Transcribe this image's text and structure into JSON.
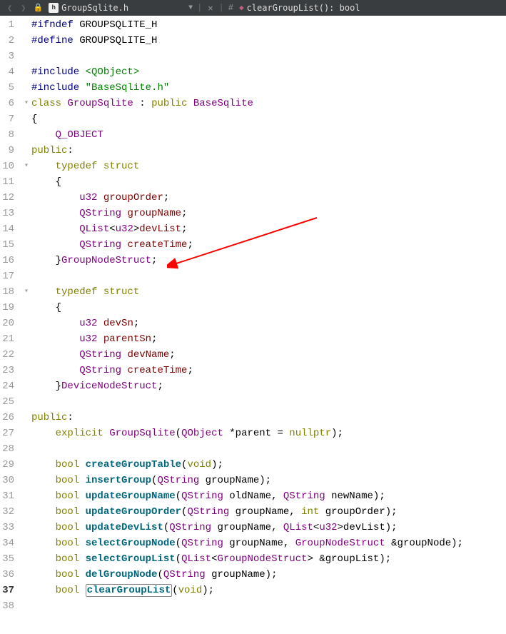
{
  "toolbar": {
    "file_icon": "h",
    "file_name": "GroupSqlite.h",
    "dropdown": "▼",
    "close": "✕",
    "sep": "|",
    "hash": "#",
    "func_icon": "◆",
    "func_sig": "clearGroupList(): bool"
  },
  "gutter": [
    "1",
    "2",
    "3",
    "4",
    "5",
    "6",
    "7",
    "8",
    "9",
    "10",
    "11",
    "12",
    "13",
    "14",
    "15",
    "16",
    "17",
    "18",
    "19",
    "20",
    "21",
    "22",
    "23",
    "24",
    "25",
    "26",
    "27",
    "28",
    "29",
    "30",
    "31",
    "32",
    "33",
    "34",
    "35",
    "36",
    "37",
    "38"
  ],
  "fold_markers": {
    "5": "▾",
    "9": "▾",
    "17": "▾"
  },
  "code": {
    "l1": {
      "a": "#ifndef",
      "b": " GROUPSQLITE_H"
    },
    "l2": {
      "a": "#define",
      "b": " GROUPSQLITE_H"
    },
    "l4": {
      "a": "#include ",
      "b": "<QObject>"
    },
    "l5": {
      "a": "#include ",
      "b": "\"BaseSqlite.h\""
    },
    "l6": {
      "a": "class ",
      "b": "GroupSqlite",
      "c": " : ",
      "d": "public ",
      "e": "BaseSqlite"
    },
    "l7": "{",
    "l8": {
      "a": "    ",
      "b": "Q_OBJECT"
    },
    "l9": {
      "a": "public",
      "b": ":"
    },
    "l10": {
      "a": "    ",
      "b": "typedef struct"
    },
    "l11": "    {",
    "l12": {
      "a": "        ",
      "b": "u32",
      "c": " ",
      "d": "groupOrder",
      "e": ";"
    },
    "l13": {
      "a": "        ",
      "b": "QString",
      "c": " ",
      "d": "groupName",
      "e": ";"
    },
    "l14": {
      "a": "        ",
      "b": "QList",
      "c": "<",
      "d": "u32",
      "e": ">",
      "f": "devList",
      "g": ";"
    },
    "l15": {
      "a": "        ",
      "b": "QString",
      "c": " ",
      "d": "createTime",
      "e": ";"
    },
    "l16": {
      "a": "    }",
      "b": "GroupNodeStruct",
      "c": ";"
    },
    "l18": {
      "a": "    ",
      "b": "typedef struct"
    },
    "l19": "    {",
    "l20": {
      "a": "        ",
      "b": "u32",
      "c": " ",
      "d": "devSn",
      "e": ";"
    },
    "l21": {
      "a": "        ",
      "b": "u32",
      "c": " ",
      "d": "parentSn",
      "e": ";"
    },
    "l22": {
      "a": "        ",
      "b": "QString",
      "c": " ",
      "d": "devName",
      "e": ";"
    },
    "l23": {
      "a": "        ",
      "b": "QString",
      "c": " ",
      "d": "createTime",
      "e": ";"
    },
    "l24": {
      "a": "    }",
      "b": "DeviceNodeStruct",
      "c": ";"
    },
    "l26": {
      "a": "public",
      "b": ":"
    },
    "l27": {
      "a": "    ",
      "b": "explicit ",
      "c": "GroupSqlite",
      "d": "(",
      "e": "QObject",
      "f": " *parent = ",
      "g": "nullptr",
      "h": ");"
    },
    "l29": {
      "a": "    ",
      "b": "bool ",
      "c": "createGroupTable",
      "d": "(",
      "e": "void",
      "f": ");"
    },
    "l30": {
      "a": "    ",
      "b": "bool ",
      "c": "insertGroup",
      "d": "(",
      "e": "QString",
      "f": " groupName);"
    },
    "l31": {
      "a": "    ",
      "b": "bool ",
      "c": "updateGroupName",
      "d": "(",
      "e": "QString",
      "f": " oldName, ",
      "g": "QString",
      "h": " newName);"
    },
    "l32": {
      "a": "    ",
      "b": "bool ",
      "c": "updateGroupOrder",
      "d": "(",
      "e": "QString",
      "f": " groupName, ",
      "g": "int",
      "h": " groupOrder);"
    },
    "l33": {
      "a": "    ",
      "b": "bool ",
      "c": "updateDevList",
      "d": "(",
      "e": "QString",
      "f": " groupName, ",
      "g": "QList",
      "h": "<",
      "i": "u32",
      "j": ">devList);"
    },
    "l34": {
      "a": "    ",
      "b": "bool ",
      "c": "selectGroupNode",
      "d": "(",
      "e": "QString",
      "f": " groupName, ",
      "g": "GroupNodeStruct",
      "h": " &groupNode);"
    },
    "l35": {
      "a": "    ",
      "b": "bool ",
      "c": "selectGroupList",
      "d": "(",
      "e": "QList",
      "f": "<",
      "g": "GroupNodeStruct",
      "h": "> &groupList);"
    },
    "l36": {
      "a": "    ",
      "b": "bool ",
      "c": "delGroupNode",
      "d": "(",
      "e": "QString",
      "f": " groupName);"
    },
    "l37": {
      "a": "    ",
      "b": "bool ",
      "c": "clearGroupList",
      "d": "(",
      "e": "void",
      "f": ");"
    }
  }
}
